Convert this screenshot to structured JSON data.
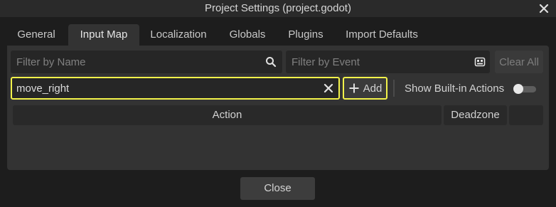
{
  "window": {
    "title": "Project Settings (project.godot)",
    "close_icon": "close-icon"
  },
  "tabs": [
    {
      "label": "General"
    },
    {
      "label": "Input Map",
      "active": true
    },
    {
      "label": "Localization"
    },
    {
      "label": "Globals"
    },
    {
      "label": "Plugins"
    },
    {
      "label": "Import Defaults"
    }
  ],
  "filter": {
    "name_placeholder": "Filter by Name",
    "event_placeholder": "Filter by Event",
    "clear_all_label": "Clear All",
    "search_icon": "search-icon",
    "keyboard_icon": "keyboard-icon"
  },
  "new_action": {
    "value": "move_right",
    "clear_icon": "clear-icon",
    "add_label": "Add",
    "add_icon": "plus-icon"
  },
  "builtin_toggle": {
    "label": "Show Built-in Actions",
    "checked": false
  },
  "table": {
    "columns": [
      "Action",
      "Deadzone",
      ""
    ]
  },
  "footer": {
    "close_label": "Close"
  },
  "colors": {
    "highlight": "#f2f24a",
    "panel": "#333333",
    "background": "#1d1d1d"
  }
}
